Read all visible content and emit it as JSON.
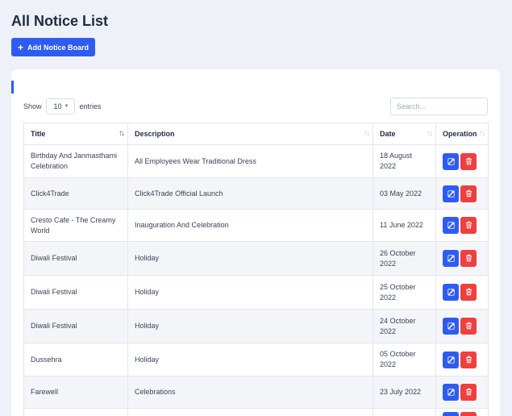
{
  "page": {
    "title": "All Notice List",
    "add_button": "Add Notice Board"
  },
  "controls": {
    "show_label": "Show",
    "entries_value": "10",
    "entries_label": "entries",
    "search_placeholder": "Search..."
  },
  "table": {
    "columns": [
      "Title",
      "Description",
      "Date",
      "Operation"
    ],
    "rows": [
      {
        "title": "Birthday And Janmasthami Celebration",
        "description": "All Employees Wear Traditional Dress",
        "date": "18 August 2022"
      },
      {
        "title": "Click4Trade",
        "description": "Click4Trade Official Launch",
        "date": "03 May 2022"
      },
      {
        "title": "Cresto Cafe - The Creamy World",
        "description": "Inauguration And Celebration",
        "date": "11 June 2022"
      },
      {
        "title": "Diwali Festival",
        "description": "Holiday",
        "date": "26 October 2022"
      },
      {
        "title": "Diwali Festival",
        "description": "Holiday",
        "date": "25 October 2022"
      },
      {
        "title": "Diwali Festival",
        "description": "Holiday",
        "date": "24 October 2022"
      },
      {
        "title": "Dussehra",
        "description": "Holiday",
        "date": "05 October 2022"
      },
      {
        "title": "Farewell",
        "description": "Celebrations",
        "date": "23 July 2022"
      },
      {
        "title": "",
        "description": "",
        "date": ""
      }
    ]
  },
  "colors": {
    "accent": "#2f5cf0",
    "danger": "#ef3f3f",
    "background": "#eef1f8"
  },
  "icons": {
    "add": "plus-icon",
    "edit": "edit-icon",
    "delete": "trash-icon",
    "sort": "sort-icon",
    "dropdown": "caret-down-icon"
  }
}
